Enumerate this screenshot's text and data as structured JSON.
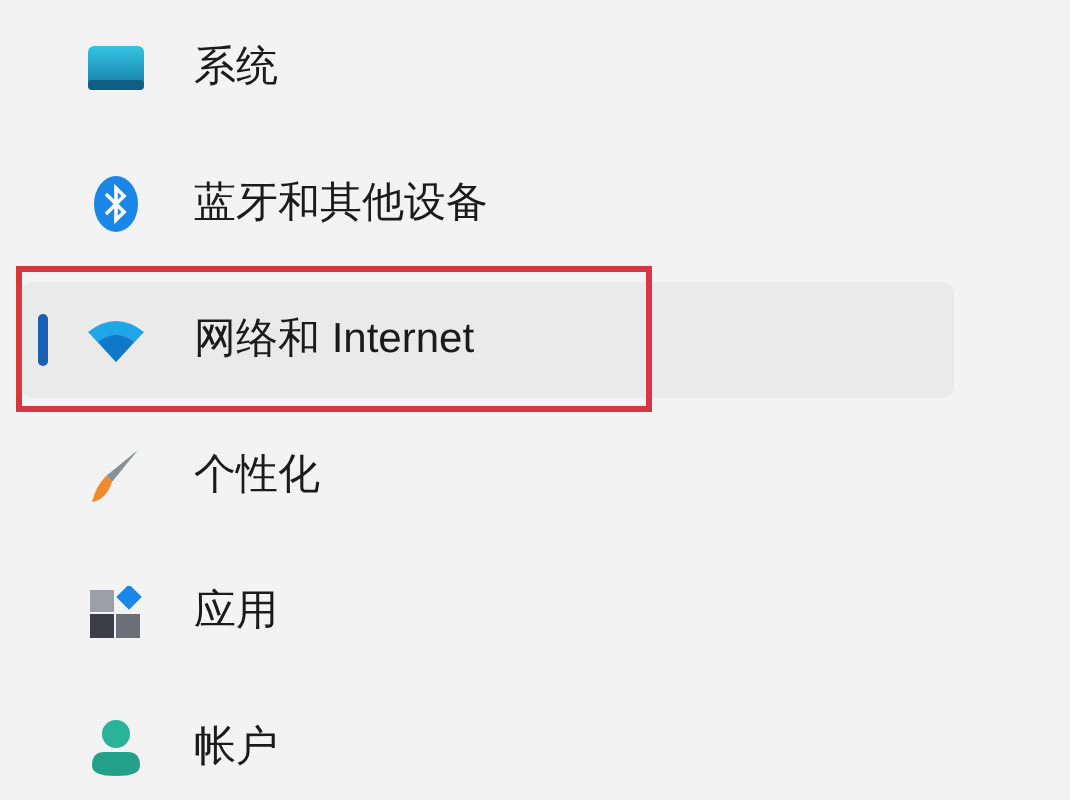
{
  "sidebar": {
    "items": [
      {
        "kind": "system",
        "label": "系统",
        "selected": false,
        "annotated": false
      },
      {
        "kind": "bluetooth",
        "label": "蓝牙和其他设备",
        "selected": false,
        "annotated": false
      },
      {
        "kind": "network",
        "label": "网络和 Internet",
        "selected": true,
        "annotated": true
      },
      {
        "kind": "personalization",
        "label": "个性化",
        "selected": false,
        "annotated": false
      },
      {
        "kind": "apps",
        "label": "应用",
        "selected": false,
        "annotated": false
      },
      {
        "kind": "accounts",
        "label": "帐户",
        "selected": false,
        "annotated": false
      }
    ]
  }
}
